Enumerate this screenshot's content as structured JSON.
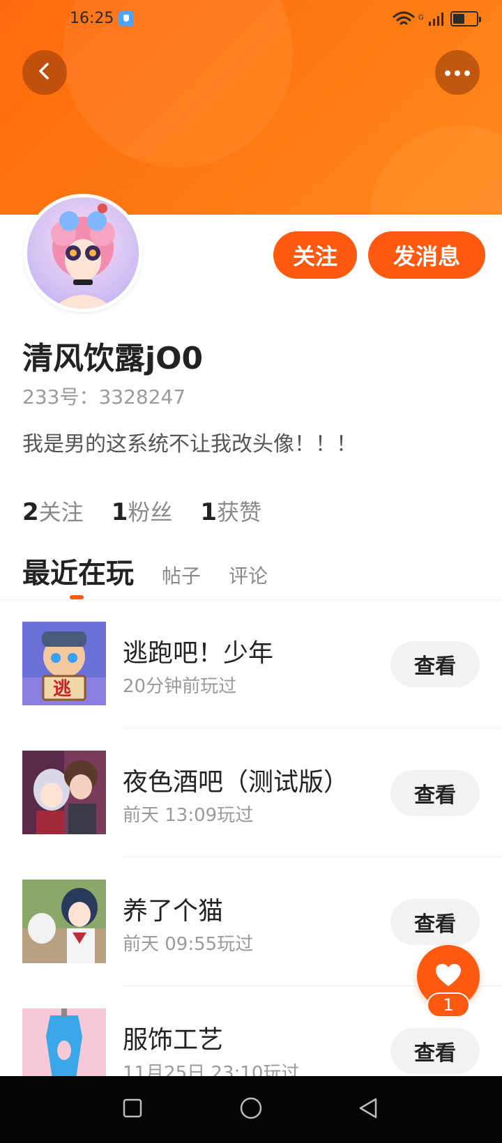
{
  "status_bar": {
    "time": "16:25",
    "network_label": "G",
    "icons": [
      "shield-icon",
      "wifi-icon",
      "signal-icon",
      "battery-icon"
    ]
  },
  "header": {
    "back_icon": "chevron-left-icon",
    "more_icon": "more-dots-icon",
    "accent_color": "#ff6a0d"
  },
  "profile": {
    "follow_label": "关注",
    "message_label": "发消息",
    "username": "清风饮露jO0",
    "user_id": "233号：3328247",
    "bio": "我是男的这系统不让我改头像！！！",
    "stats": [
      {
        "num": "2",
        "label": "关注"
      },
      {
        "num": "1",
        "label": "粉丝"
      },
      {
        "num": "1",
        "label": "获赞"
      }
    ]
  },
  "tabs": [
    {
      "label": "最近在玩",
      "active": true
    },
    {
      "label": "帖子",
      "active": false
    },
    {
      "label": "评论",
      "active": false
    }
  ],
  "games": [
    {
      "title": "逃跑吧！少年",
      "time": "20分钟前玩过",
      "button": "查看",
      "thumb_text": "逃"
    },
    {
      "title": "夜色酒吧（测试版）",
      "time": "前天 13:09玩过",
      "button": "查看"
    },
    {
      "title": "养了个猫",
      "time": "前天 09:55玩过",
      "button": "查看"
    },
    {
      "title": "服饰工艺",
      "time": "11月25日 23:10玩过",
      "button": "查看"
    }
  ],
  "fab": {
    "icon": "heart-icon",
    "badge": "1"
  },
  "nav_bar": {
    "icons": [
      "recents-square-icon",
      "home-circle-icon",
      "back-triangle-icon"
    ]
  }
}
